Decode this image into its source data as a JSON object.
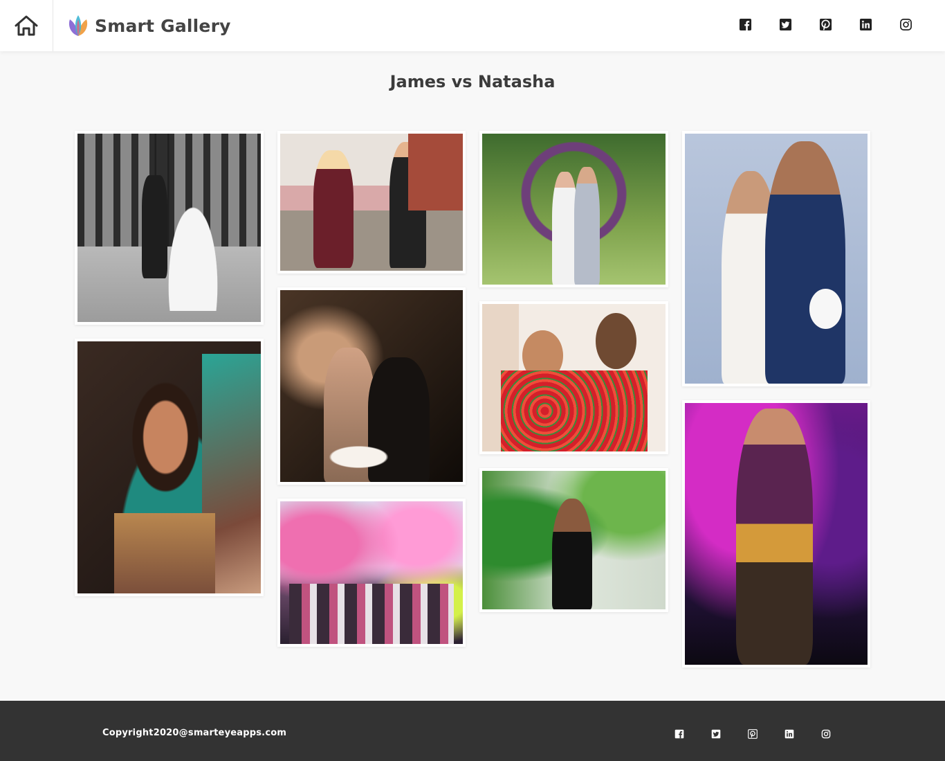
{
  "header": {
    "brand_name": "Smart Gallery",
    "social": [
      "facebook-icon",
      "twitter-icon",
      "pinterest-icon",
      "linkedin-icon",
      "instagram-icon"
    ]
  },
  "page": {
    "title": "James vs Natasha"
  },
  "gallery": {
    "photos": [
      "bridge-wedding-couple",
      "bicycle-couple-street",
      "floral-arch-wedding",
      "blue-suit-couple",
      "bride-teal-saree",
      "birthday-candles-cake",
      "garland-wedding",
      "holi-color-festival",
      "woman-green-leaves",
      "runway-model-purple"
    ]
  },
  "footer": {
    "copyright": "Copyright2020@smarteyeapps.com",
    "social": [
      "facebook-icon",
      "twitter-icon",
      "pinterest-icon",
      "linkedin-icon",
      "instagram-icon"
    ]
  },
  "colors": {
    "background": "#f8f8f8",
    "header": "#ffffff",
    "footer": "#333333",
    "title": "#3b3b3b"
  }
}
